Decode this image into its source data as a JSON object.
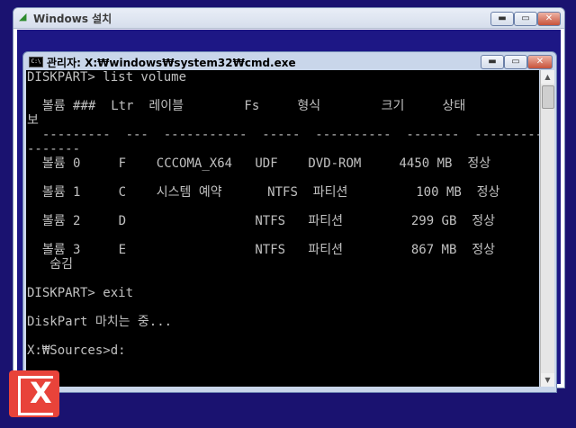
{
  "setup": {
    "title": "Windows 설치",
    "icon": "setup-icon",
    "buttons": {
      "minimize": "▬",
      "maximize": "▭",
      "close": "✕"
    }
  },
  "cmd": {
    "icon_text": "C:\\",
    "title": "관리자: X:₩windows₩system32₩cmd.exe",
    "buttons": {
      "minimize": "▬",
      "maximize": "▭",
      "close": "✕"
    }
  },
  "console": {
    "lines": [
      "DISKPART> list volume",
      "",
      "  볼륨 ###  Ltr  레이블        Fs     형식        크기     상태          정",
      "보",
      "  ---------  ---  -----------  -----  ----------  -------  ------------  ---",
      "-------",
      "  볼륨 0     F    CCCOMA_X64   UDF    DVD-ROM     4450 MB  정상",
      "",
      "  볼륨 1     C    시스템 예약      NTFS  파티션         100 MB  정상",
      "",
      "  볼륨 2     D                 NTFS   파티션         299 GB  정상",
      "",
      "  볼륨 3     E                 NTFS   파티션         867 MB  정상",
      "   숨김",
      "",
      "DISKPART> exit",
      "",
      "DiskPart 마치는 중...",
      "",
      "X:₩Sources>d:",
      ""
    ]
  },
  "colors": {
    "desktop": "#1a1270",
    "console_bg": "#000000",
    "console_text": "#c0c0c0",
    "logo": "#e8433a"
  },
  "logo": {
    "icon": "brand-logo-icon",
    "glyph": "X"
  }
}
